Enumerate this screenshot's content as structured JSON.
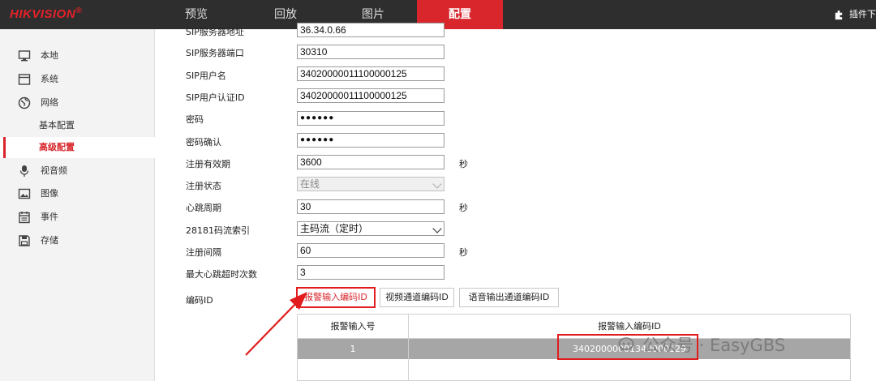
{
  "brand": {
    "logo": "HIKVISION",
    "reg": "®"
  },
  "nav": [
    {
      "label": "预览"
    },
    {
      "label": "回放"
    },
    {
      "label": "图片"
    },
    {
      "label": "配置"
    }
  ],
  "plugin": {
    "label": "插件下"
  },
  "sidebar": {
    "items": [
      {
        "label": "本地",
        "icon": "monitor-icon"
      },
      {
        "label": "系统",
        "icon": "window-icon"
      },
      {
        "label": "网络",
        "icon": "globe-icon"
      }
    ],
    "network_sub": [
      {
        "label": "基本配置"
      },
      {
        "label": "高级配置"
      }
    ],
    "items2": [
      {
        "label": "视音频",
        "icon": "microphone-icon"
      },
      {
        "label": "图像",
        "icon": "image-icon"
      },
      {
        "label": "事件",
        "icon": "calendar-icon"
      },
      {
        "label": "存储",
        "icon": "floppy-icon"
      }
    ]
  },
  "form": {
    "sip_server_addr": {
      "label": "SIP服务器地址",
      "value": "36.34.0.66"
    },
    "sip_server_port": {
      "label": "SIP服务器端口",
      "value": "30310"
    },
    "sip_username": {
      "label": "SIP用户名",
      "value": "34020000011100000125"
    },
    "sip_auth_id": {
      "label": "SIP用户认证ID",
      "value": "34020000011100000125"
    },
    "password": {
      "label": "密码",
      "value": "●●●●●●"
    },
    "password_confirm": {
      "label": "密码确认",
      "value": "●●●●●●"
    },
    "reg_validity": {
      "label": "注册有效期",
      "value": "3600",
      "unit": "秒"
    },
    "reg_status": {
      "label": "注册状态",
      "value": "在线"
    },
    "heartbeat": {
      "label": "心跳周期",
      "value": "30",
      "unit": "秒"
    },
    "stream_index": {
      "label": "28181码流索引",
      "value": "主码流（定时）"
    },
    "reg_interval": {
      "label": "注册间隔",
      "value": "60",
      "unit": "秒"
    },
    "max_heartbeat": {
      "label": "最大心跳超时次数",
      "value": "3"
    },
    "encode_id": {
      "label": "编码ID"
    }
  },
  "tabs": [
    {
      "label": "报警输入编码ID"
    },
    {
      "label": "视频通道编码ID"
    },
    {
      "label": "语音输出通道编码ID"
    }
  ],
  "table": {
    "columns": [
      "报警输入号",
      "报警输入编码ID"
    ],
    "rows": [
      {
        "num": "1",
        "id": "34020000001340000129"
      }
    ]
  },
  "watermark": {
    "text": "公众号 · EasyGBS"
  },
  "colors": {
    "topbar": "#2e2e2e",
    "accent": "#d8262c",
    "annotation": "#e21c1c"
  }
}
